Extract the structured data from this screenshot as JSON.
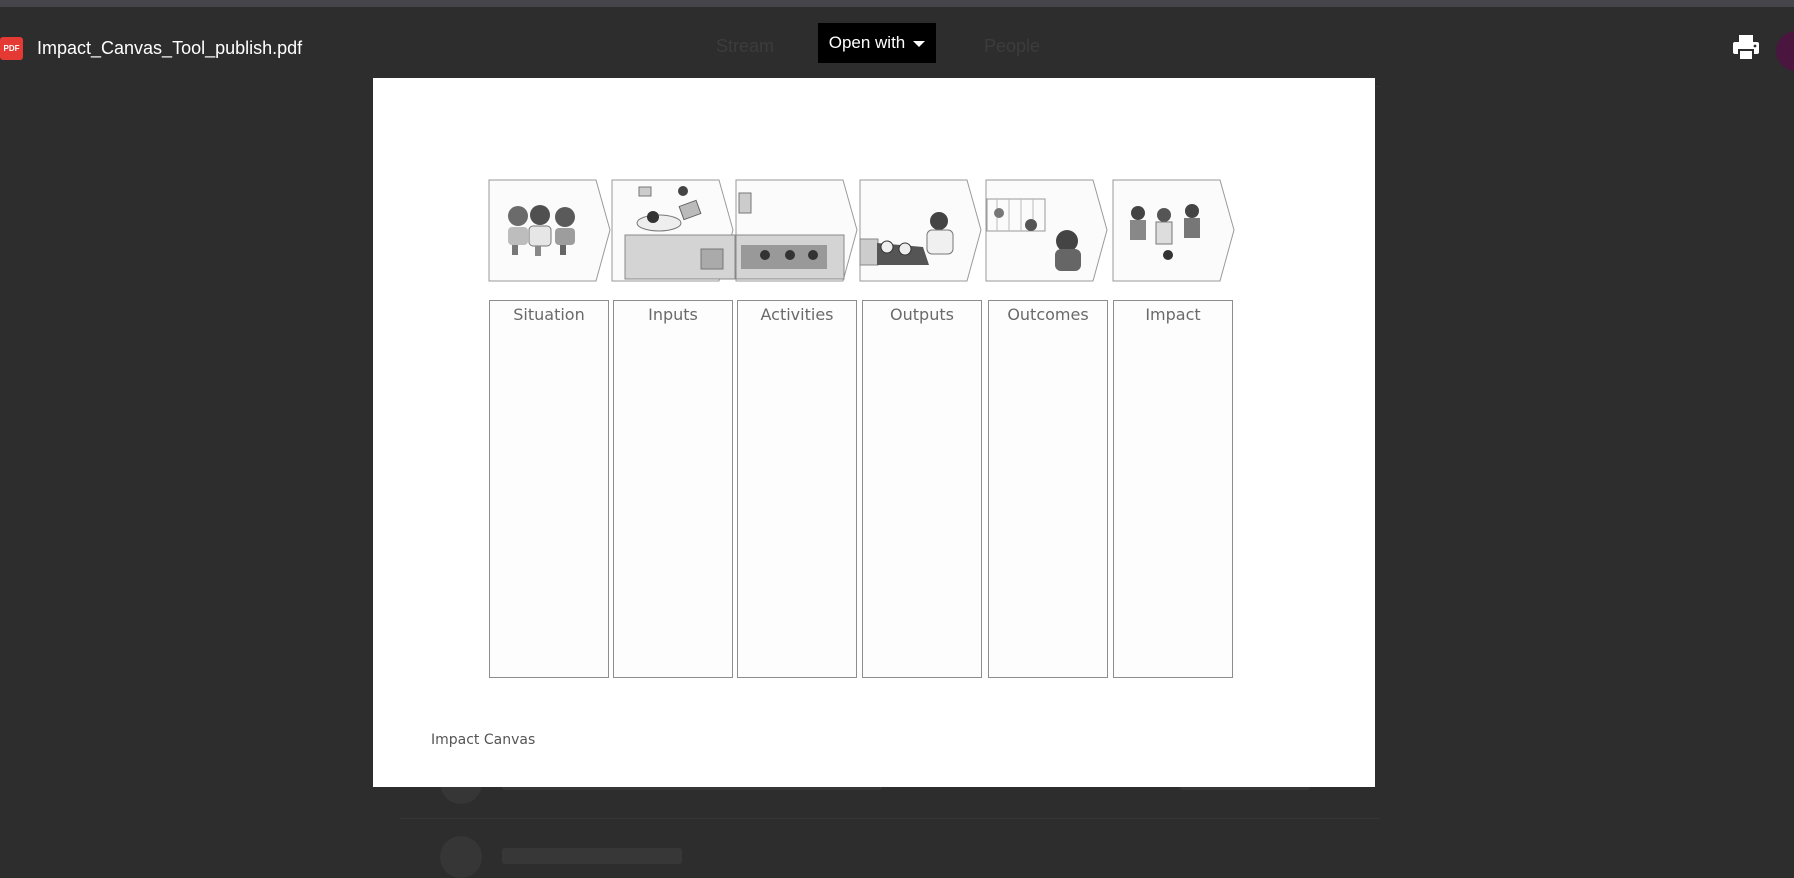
{
  "viewer": {
    "file_name": "Impact_Canvas_Tool_publish.pdf",
    "file_type_badge": "PDF",
    "open_with_label": "Open with"
  },
  "document": {
    "columns": [
      {
        "label": "Situation"
      },
      {
        "label": "Inputs"
      },
      {
        "label": "Activities"
      },
      {
        "label": "Outputs"
      },
      {
        "label": "Outcomes"
      },
      {
        "label": "Impact"
      }
    ],
    "footer": "Impact Canvas"
  },
  "background_page": {
    "tabs": [
      "Stream",
      "People"
    ]
  },
  "colors": {
    "backdrop": "#2d2d2d",
    "pdf_badge": "#e43a33",
    "button": "#000000",
    "page": "#ffffff"
  }
}
